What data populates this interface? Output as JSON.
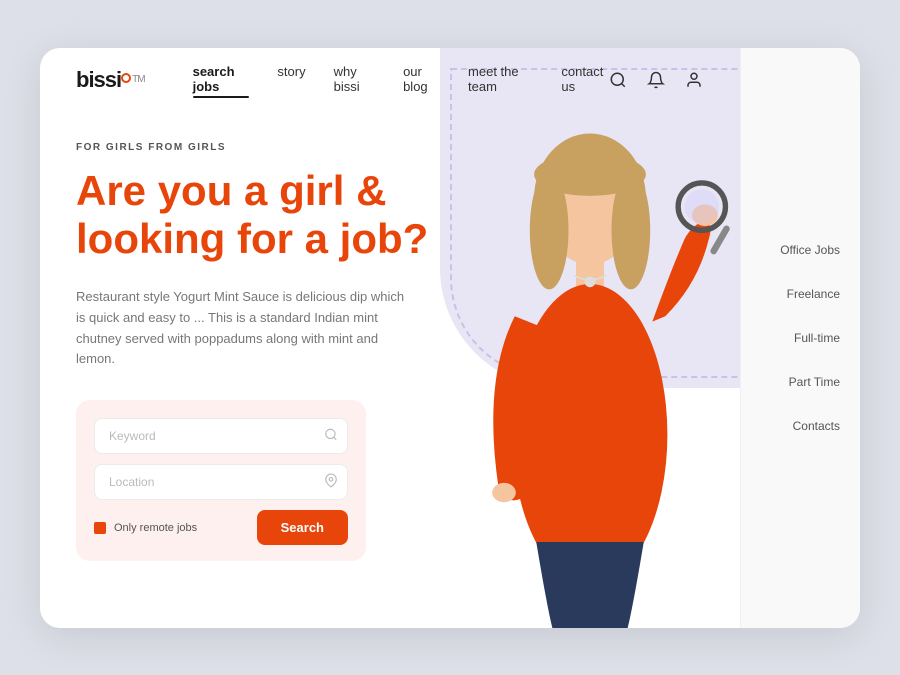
{
  "logo": {
    "text": "bissi",
    "tm": "TM"
  },
  "nav": {
    "links": [
      {
        "label": "search jobs",
        "active": true
      },
      {
        "label": "story",
        "active": false
      },
      {
        "label": "why bissi",
        "active": false
      },
      {
        "label": "our blog",
        "active": false
      },
      {
        "label": "meet the team",
        "active": false
      },
      {
        "label": "contact us",
        "active": false
      }
    ]
  },
  "hero": {
    "tagline": "FOR GIRLS FROM GIRLS",
    "headline": "Are you a girl & looking for a job?",
    "description": "Restaurant style Yogurt Mint Sauce is delicious dip which is quick and easy to ... This is a standard Indian mint chutney served with poppadums along with mint and lemon."
  },
  "search": {
    "keyword_placeholder": "Keyword",
    "location_placeholder": "Location",
    "remote_label": "Only remote jobs",
    "button_label": "Search"
  },
  "sidebar": {
    "items": [
      {
        "label": "Office Jobs"
      },
      {
        "label": "Freelance"
      },
      {
        "label": "Full-time"
      },
      {
        "label": "Part Time"
      },
      {
        "label": "Contacts"
      }
    ]
  },
  "colors": {
    "accent": "#e8450a",
    "bg_blob": "#e8e5f4"
  }
}
